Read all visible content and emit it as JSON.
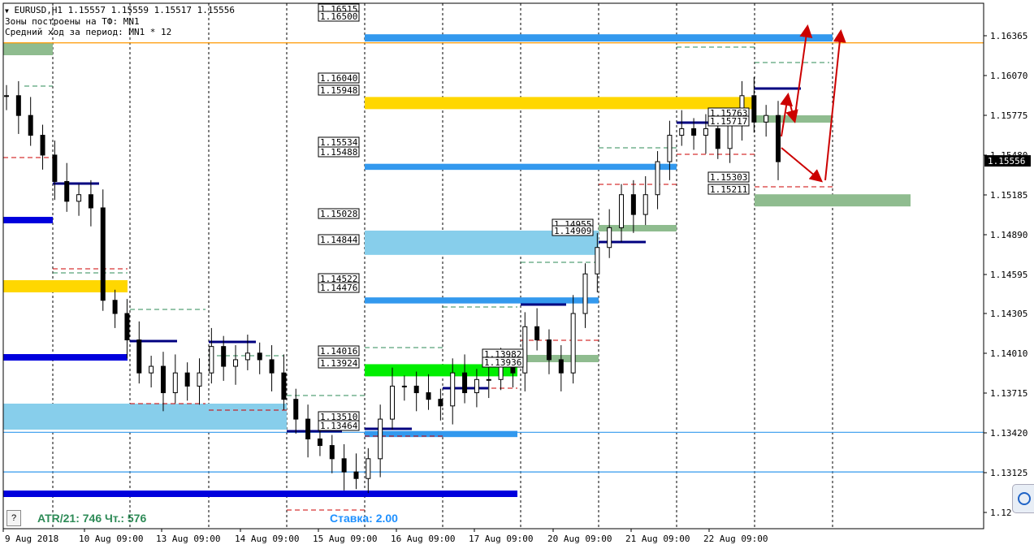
{
  "header": {
    "symbol_line": "EURUSD,H1  1.15557 1.15559 1.15517 1.15556",
    "zones_line": "Зоны построены на ТФ: MN1",
    "avg_line": "Средний ход за период: MN1 * 12"
  },
  "footer": {
    "help_label": "?",
    "atr_text": "ATR/21: 746  Чт.: 576",
    "rate_text": "Ставка: 2.00"
  },
  "colors": {
    "blue_level": "#3399ee",
    "dark_blue_level": "#0000dd",
    "yellow_zone": "#ffd700",
    "light_blue_zone": "#87ceeb",
    "green_zone": "#8fbc8f",
    "bright_green_zone": "#00ee00",
    "orange_line": "#ff9900",
    "red_arrows": "#cc0000",
    "atr_text": "#2e8b57",
    "rate_text": "#1e90ff"
  },
  "chart_data": {
    "type": "candlestick",
    "symbol": "EURUSD",
    "timeframe": "H1",
    "current_price": 1.15556,
    "current_price_label": "1.15556",
    "ylim": [
      1.1277,
      1.1675
    ],
    "y_ticks": [
      "1.16365",
      "1.16070",
      "1.15775",
      "1.15480",
      "1.15185",
      "1.14890",
      "1.14595",
      "1.14305",
      "1.14010",
      "1.13715",
      "1.13420",
      "1.13125",
      "1.12"
    ],
    "x_ticks": [
      "9 Aug 2018",
      "10 Aug 09:00",
      "13 Aug 09:00",
      "14 Aug 09:00",
      "15 Aug 09:00",
      "16 Aug 09:00",
      "17 Aug 09:00",
      "20 Aug 09:00",
      "21 Aug 09:00",
      "22 Aug 09:00"
    ],
    "horizontal_lines": [
      {
        "price": 1.1645,
        "color": "orange"
      },
      {
        "price": 1.135,
        "color": "blue"
      },
      {
        "price": 1.132,
        "color": "blue"
      }
    ],
    "zones": [
      {
        "name": "blue",
        "price_top": 1.16515,
        "price_bottom": 1.1646,
        "x_from": "15 Aug 09:00",
        "x_to": "22 Aug 09:00+"
      },
      {
        "name": "yellow",
        "price_top": 1.1604,
        "price_bottom": 1.15948,
        "x_from": "15 Aug 09:00",
        "x_to": "22 Aug 09:00"
      },
      {
        "name": "blue",
        "price_top": 1.15534,
        "price_bottom": 1.15488,
        "x_from": "15 Aug 09:00",
        "x_to": "21 Aug 09:00"
      },
      {
        "name": "light-blue",
        "price_top": 1.15028,
        "price_bottom": 1.14844,
        "x_from": "15 Aug 09:00",
        "x_to": "20 Aug 09:00"
      },
      {
        "name": "blue",
        "price_top": 1.14522,
        "price_bottom": 1.14476,
        "x_from": "15 Aug 09:00",
        "x_to": "20 Aug 09:00"
      },
      {
        "name": "bright-green",
        "price_top": 1.14016,
        "price_bottom": 1.13924,
        "x_from": "15 Aug 09:00",
        "x_to": "17 Aug 09:00"
      },
      {
        "name": "blue",
        "price_top": 1.1351,
        "price_bottom": 1.13464,
        "x_from": "15 Aug 09:00",
        "x_to": "17 Aug 09:00"
      },
      {
        "name": "green",
        "price_top": 1.15303,
        "price_bottom": 1.15211,
        "x_from": "22 Aug 09:00",
        "x_to": "22 Aug 09:00+"
      }
    ],
    "price_labels": [
      "1.16515",
      "1.16500",
      "1.16040",
      "1.15948",
      "1.15534",
      "1.15488",
      "1.15028",
      "1.14844",
      "1.14522",
      "1.14476",
      "1.14016",
      "1.13924",
      "1.13510",
      "1.13464",
      "1.15303",
      "1.15211",
      "1.15763",
      "1.15717",
      "1.14955",
      "1.14909",
      "1.13982",
      "1.13936"
    ],
    "close_series": [
      1.1605,
      1.159,
      1.1575,
      1.156,
      1.154,
      1.1525,
      1.153,
      1.152,
      1.145,
      1.144,
      1.142,
      1.1395,
      1.14,
      1.138,
      1.1395,
      1.1385,
      1.1395,
      1.1415,
      1.14,
      1.1405,
      1.141,
      1.1405,
      1.1395,
      1.1375,
      1.136,
      1.1345,
      1.134,
      1.133,
      1.132,
      1.1315,
      1.133,
      1.136,
      1.1385,
      1.1385,
      1.138,
      1.1375,
      1.137,
      1.1395,
      1.138,
      1.139,
      1.139,
      1.14,
      1.1395,
      1.143,
      1.142,
      1.1405,
      1.1395,
      1.144,
      1.147,
      1.149,
      1.1505,
      1.153,
      1.1515,
      1.153,
      1.1555,
      1.1575,
      1.158,
      1.1575,
      1.158,
      1.1565,
      1.1585,
      1.1605,
      1.1585,
      1.159,
      1.1555
    ]
  }
}
